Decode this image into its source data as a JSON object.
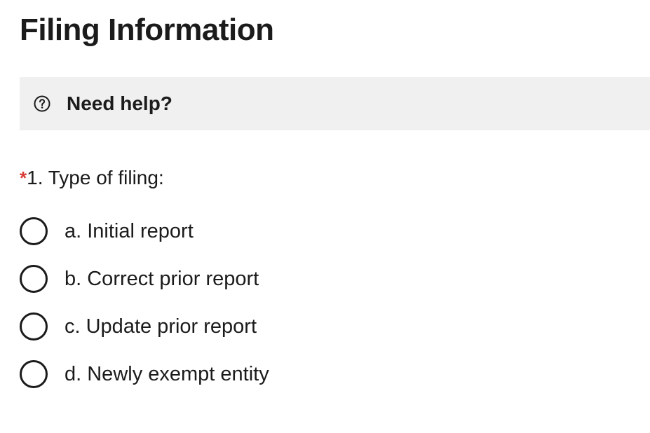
{
  "page": {
    "title": "Filing Information"
  },
  "help": {
    "icon": "question-circle-icon",
    "label": "Need help?"
  },
  "question": {
    "required_marker": "*",
    "label": "1. Type of filing:",
    "required_color": "#d83933"
  },
  "options": [
    {
      "label": "a. Initial report",
      "selected": false
    },
    {
      "label": "b. Correct prior report",
      "selected": false
    },
    {
      "label": "c. Update prior report",
      "selected": false
    },
    {
      "label": "d. Newly exempt entity",
      "selected": false
    }
  ],
  "colors": {
    "help_background": "#f0f0f0",
    "text": "#1b1b1b"
  }
}
